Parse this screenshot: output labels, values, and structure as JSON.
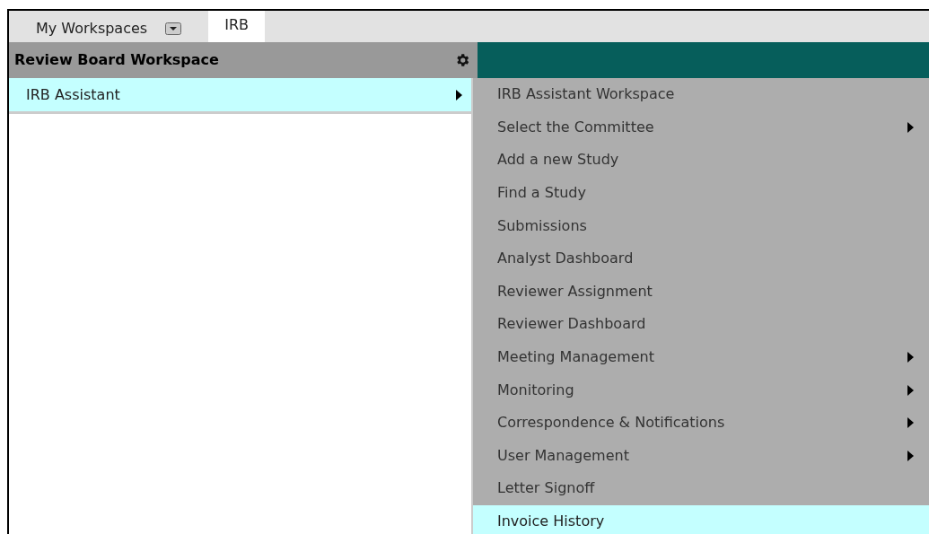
{
  "tabs": [
    {
      "label": "My Workspaces",
      "kind": "dropdown",
      "selected": false
    },
    {
      "label": "IRB",
      "kind": "plain",
      "selected": true
    }
  ],
  "sidebar": {
    "title": "Review Board Workspace",
    "items": [
      {
        "label": "IRB Assistant",
        "has_submenu": true,
        "selected": true
      }
    ]
  },
  "submenu": {
    "items": [
      {
        "label": "IRB Assistant Workspace",
        "has_submenu": false,
        "selected": false
      },
      {
        "label": "Select the Committee",
        "has_submenu": true,
        "selected": false
      },
      {
        "label": "Add a new Study",
        "has_submenu": false,
        "selected": false
      },
      {
        "label": "Find a Study",
        "has_submenu": false,
        "selected": false
      },
      {
        "label": "Submissions",
        "has_submenu": false,
        "selected": false
      },
      {
        "label": "Analyst Dashboard",
        "has_submenu": false,
        "selected": false
      },
      {
        "label": "Reviewer Assignment",
        "has_submenu": false,
        "selected": false
      },
      {
        "label": "Reviewer Dashboard",
        "has_submenu": false,
        "selected": false
      },
      {
        "label": "Meeting Management",
        "has_submenu": true,
        "selected": false
      },
      {
        "label": "Monitoring",
        "has_submenu": true,
        "selected": false
      },
      {
        "label": "Correspondence & Notifications",
        "has_submenu": true,
        "selected": false
      },
      {
        "label": "User Management",
        "has_submenu": true,
        "selected": false
      },
      {
        "label": "Letter Signoff",
        "has_submenu": false,
        "selected": false
      },
      {
        "label": "Invoice History",
        "has_submenu": false,
        "selected": true
      }
    ]
  }
}
